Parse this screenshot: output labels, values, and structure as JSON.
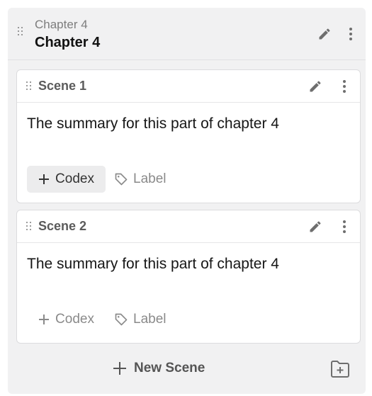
{
  "chapter": {
    "subtitle": "Chapter 4",
    "title": "Chapter 4",
    "icons": {
      "drag": "drag-handle-icon",
      "edit": "pencil-icon",
      "more": "more-vertical-icon"
    }
  },
  "scenes": [
    {
      "title": "Scene 1",
      "summary": "The summary for this part of chapter 4",
      "codex_label": "Codex",
      "label_label": "Label",
      "codex_active": true
    },
    {
      "title": "Scene 2",
      "summary": "The summary for this part of chapter 4",
      "codex_label": "Codex",
      "label_label": "Label",
      "codex_active": false
    }
  ],
  "footer": {
    "new_scene_label": "New Scene",
    "icons": {
      "add": "plus-icon",
      "folder": "folder-plus-icon"
    }
  },
  "colors": {
    "panel_bg": "#f1f1f2",
    "card_bg": "#ffffff",
    "border": "#dcdcde",
    "muted_text": "#8a8a8a"
  }
}
